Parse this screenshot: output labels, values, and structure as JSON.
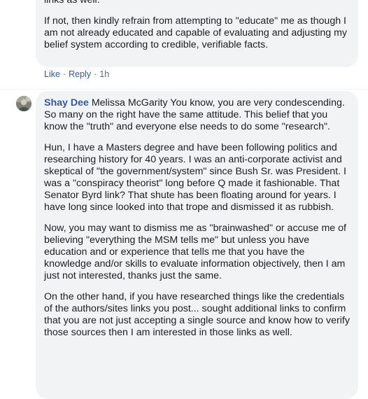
{
  "top_comment": {
    "lines_partial": "links as well.",
    "paragraph": "If not, then kindly refrain from attempting to \"educate\" me as though I am not already educated and capable of evaluating and adjusting my belief system according to credible, verifiable facts.",
    "actions": {
      "like": "Like",
      "reply": "Reply",
      "time": "1h",
      "separator": "·"
    }
  },
  "main_comment": {
    "author": "Shay Dee",
    "paragraph1": "Melissa McGarity You know, you are very condescending. So many on the right have the same attitude. This belief that you know the \"truth\" and everyone else needs to do some \"research\".",
    "paragraph2": "Hun, I have a Masters degree and have been following politics and researching history for 40 years. I was an anti-corporate activist and skeptical of \"the government/system\" since Bush Sr. was President. I was a \"conspiracy theorist\" long before Q made it fashionable. That Senator Byrd link? That shute has been floating around for years. I have long since looked into that trope and dismissed it as rubbish.",
    "paragraph3": "Now, you may want to dismiss me as \"brainwashed\" or accuse me of believing \"everything the MSM tells me\" but unless you have education and or experience that tells me that you have the knowledge and/or skills to evaluate information objectively, then I am just not interested, thanks just the same.",
    "paragraph4": "On the other hand, if you have researched things like the credentials of the authors/sites links you post... sought additional links to confirm that you are not just accepting a single source and know how to verify those sources then I am interested in those links as well."
  }
}
